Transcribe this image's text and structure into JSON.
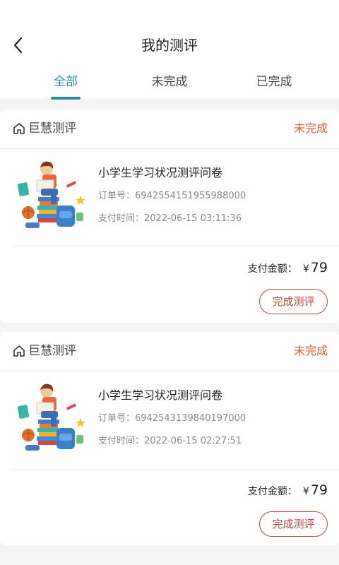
{
  "header": {
    "title": "我的测评",
    "back_icon": "chevron-left-icon"
  },
  "tabs": [
    {
      "label": "全部",
      "active": true
    },
    {
      "label": "未完成",
      "active": false
    },
    {
      "label": "已完成",
      "active": false
    }
  ],
  "colors": {
    "accent": "#2a8a9a",
    "status": "#e2583a",
    "button_border": "#b9453a"
  },
  "orders": [
    {
      "shop": "巨慧测评",
      "shop_icon": "home-icon",
      "status": "未完成",
      "product_title": "小学生学习状况测评问卷",
      "thumb_icon": "student-reading-illustration",
      "order_no_label": "订单号：",
      "order_no": "6942554151955988000",
      "pay_time_label": "支付时间：",
      "pay_time": "2022-06-15 03:11:36",
      "amount_label": "支付金额：",
      "currency": "¥",
      "amount": "79",
      "action": "完成测评"
    },
    {
      "shop": "巨慧测评",
      "shop_icon": "home-icon",
      "status": "未完成",
      "product_title": "小学生学习状况测评问卷",
      "thumb_icon": "student-reading-illustration",
      "order_no_label": "订单号：",
      "order_no": "6942543139840197000",
      "pay_time_label": "支付时间：",
      "pay_time": "2022-06-15 02:27:51",
      "amount_label": "支付金额：",
      "currency": "¥",
      "amount": "79",
      "action": "完成测评"
    }
  ]
}
